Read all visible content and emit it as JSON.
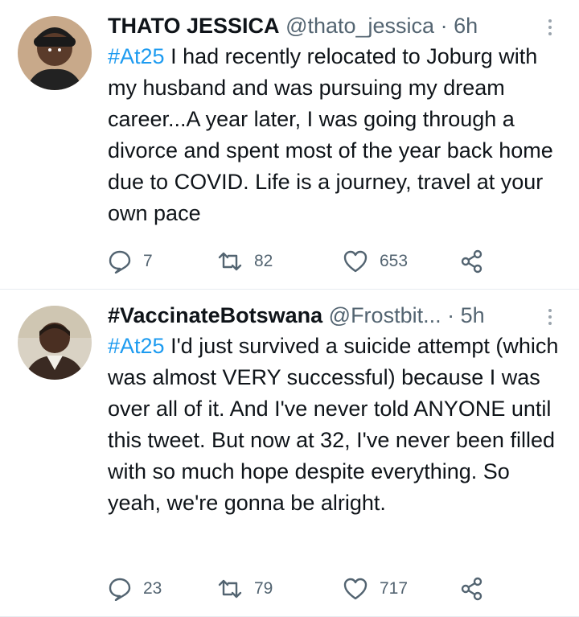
{
  "tweets": [
    {
      "name": "THATO JESSICA",
      "handle": "@thato_jessica",
      "dot": "·",
      "time": "6h",
      "hashtag": "#At25",
      "text": " I had recently relocated to Joburg with my husband and was pursuing my dream career...A year later, I was going through a divorce and spent most of the year back home due to COVID. Life is a journey, travel at your own pace",
      "replies": "7",
      "retweets": "82",
      "likes": "653"
    },
    {
      "name": "#VaccinateBotswana",
      "handle": "@Frostbit...",
      "dot": "·",
      "time": "5h",
      "hashtag": "#At25",
      "text": " I'd just survived a suicide attempt (which was almost VERY successful) because I was over all of it. And I've never told ANYONE until this tweet. But now at 32, I've never been filled with so much hope despite everything. So yeah, we're gonna be alright.",
      "replies": "23",
      "retweets": "79",
      "likes": "717"
    }
  ],
  "icons": {
    "reply": "speech-bubble-icon",
    "retweet": "retweet-arrows-icon",
    "like": "heart-icon",
    "share": "share-nodes-icon",
    "more": "more-dots-icon"
  },
  "colors": {
    "hashtag": "#1d9bf0",
    "secondary_text": "#536471",
    "divider": "#e6ecf0"
  }
}
